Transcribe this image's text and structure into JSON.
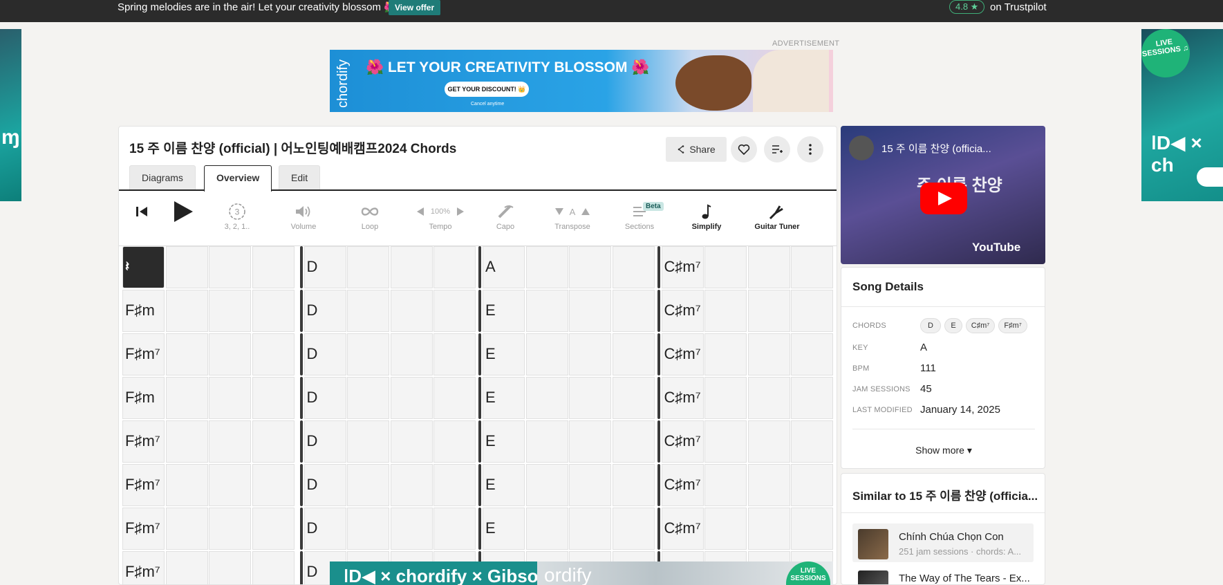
{
  "promo": {
    "text": "Spring melodies are in the air! Let your creativity blossom 🌺",
    "button": "View offer",
    "rating": "4.8 ★",
    "rating_source": "on Trustpilot"
  },
  "ads": {
    "label": "ADVERTISEMENT",
    "banner_headline": "🌺 LET YOUR CREATIVITY BLOSSOM 🌺",
    "banner_cta": "GET YOUR DISCOUNT! 👑",
    "banner_cancel": "Cancel anytime",
    "banner_logo": "chordify",
    "side_badge": "LIVE SESSIONS ♫",
    "bottom_brand": "ǀD◀ × chordify × Gibson",
    "bottom_brand2": "ordify",
    "bottom_badge": "LIVE SESSIONS"
  },
  "song": {
    "title": "15 주 이름 찬양 (official) | 어노인팅예배캠프2024 Chords",
    "share_label": "Share"
  },
  "tabs": [
    "Diagrams",
    "Overview",
    "Edit"
  ],
  "toolbar": {
    "countdown_label": "3, 2, 1..",
    "countdown_value": "3",
    "volume_label": "Volume",
    "loop_label": "Loop",
    "tempo_label": "Tempo",
    "tempo_value": "100%",
    "capo_label": "Capo",
    "transpose_label": "Transpose",
    "transpose_value": "A",
    "sections_label": "Sections",
    "sections_badge": "Beta",
    "simplify_label": "Simplify",
    "tuner_label": "Guitar Tuner"
  },
  "grid": {
    "rest_symbol": "𝄽",
    "rows": [
      [
        "",
        "D",
        "A",
        "C♯m⁷"
      ],
      [
        "F♯m",
        "D",
        "E",
        "C♯m⁷"
      ],
      [
        "F♯m⁷",
        "D",
        "E",
        "C♯m⁷"
      ],
      [
        "F♯m",
        "D",
        "E",
        "C♯m⁷"
      ],
      [
        "F♯m⁷",
        "D",
        "E",
        "C♯m⁷"
      ],
      [
        "F♯m⁷",
        "D",
        "E",
        "C♯m⁷"
      ],
      [
        "F♯m⁷",
        "D",
        "E",
        "C♯m⁷"
      ],
      [
        "F♯m⁷",
        "D",
        "",
        ""
      ]
    ]
  },
  "video": {
    "title": "15 주 이름 찬양 (officia...",
    "overlay_text": "주 이름 찬양",
    "brand": "YouTube"
  },
  "details": {
    "title": "Song Details",
    "chords_label": "CHORDS",
    "chords": [
      "D",
      "E",
      "C♯m⁷",
      "F♯m⁷"
    ],
    "key_label": "KEY",
    "key": "A",
    "bpm_label": "BPM",
    "bpm": "111",
    "jam_label": "JAM SESSIONS",
    "jam": "45",
    "modified_label": "LAST MODIFIED",
    "modified": "January 14, 2025",
    "show_more": "Show more ▾"
  },
  "similar": {
    "title": "Similar to 15 주 이름 찬양 (officia...",
    "items": [
      {
        "name": "Chính Chúa Chọn Con",
        "meta": "251 jam sessions · chords: A..."
      },
      {
        "name": "The Way of The Tears - Ex...",
        "meta": ""
      }
    ]
  }
}
